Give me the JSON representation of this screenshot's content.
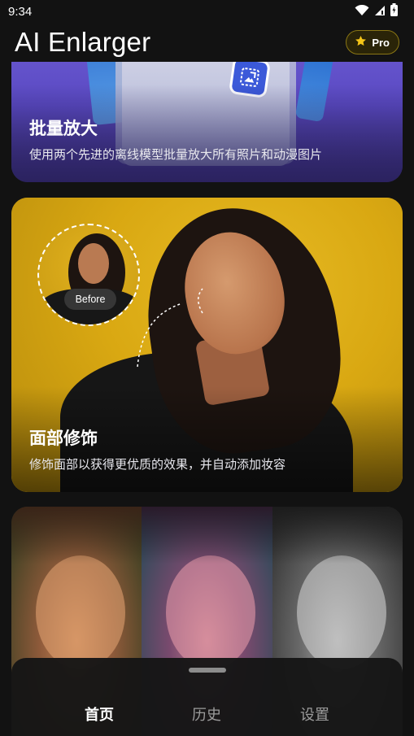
{
  "status_bar": {
    "time": "9:34"
  },
  "header": {
    "title": "AI Enlarger",
    "pro_label": "Pro"
  },
  "cards": [
    {
      "title": "批量放大",
      "description": "使用两个先进的离线模型批量放大所有照片和动漫图片"
    },
    {
      "title": "面部修饰",
      "description": "修饰面部以获得更优质的效果，并自动添加妆容",
      "before_label": "Before"
    }
  ],
  "bottom_nav": {
    "items": [
      {
        "label": "首页",
        "active": true
      },
      {
        "label": "历史",
        "active": false
      },
      {
        "label": "设置",
        "active": false
      }
    ]
  },
  "colors": {
    "background": "#121212",
    "batch_card": "#5a49c2",
    "face_card": "#dcae1a",
    "pro_border": "#8a7614",
    "pro_star": "#f5c518"
  }
}
